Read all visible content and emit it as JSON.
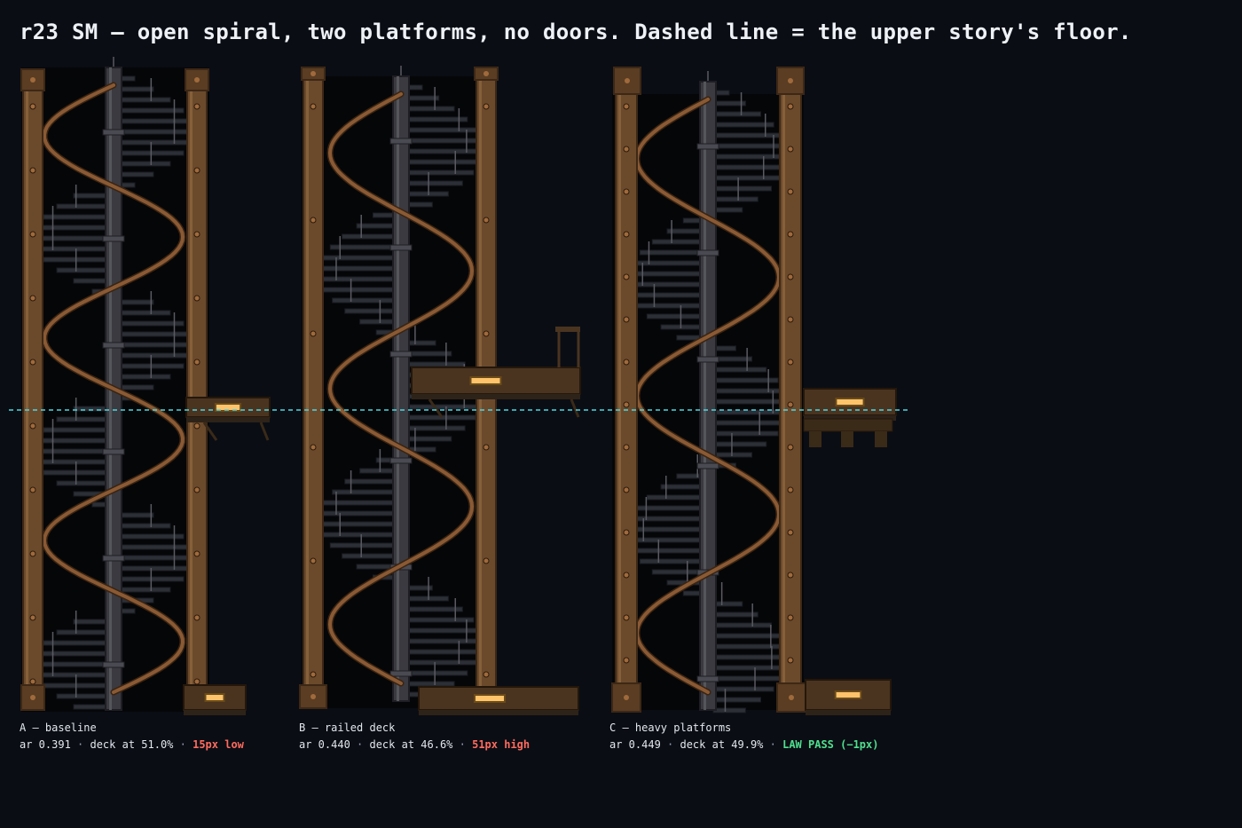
{
  "title": "r23 SM — open spiral, two platforms, no doors. Dashed line = the upper story's floor.",
  "colors": {
    "background": "#0a0d14",
    "beam": "#6b4a2c",
    "beam_dark": "#3d2816",
    "rivet": "#a06a3c",
    "pole": "#3a3a40",
    "step": "#2c2f36",
    "rail": "#8a5a34",
    "lamp": "#ffc46b",
    "dash_line": "#4fd6e0",
    "bad": "#ff6b5f",
    "good": "#4fe08e"
  },
  "variants": [
    {
      "label": "A — baseline",
      "ar": "ar 0.391",
      "deck": "deck at 51.0%",
      "verdict": "15px low",
      "verdict_status": "bad"
    },
    {
      "label": "B — railed deck",
      "ar": "ar 0.440",
      "deck": "deck at 46.6%",
      "verdict": "51px high",
      "verdict_status": "bad"
    },
    {
      "label": "C — heavy platforms",
      "ar": "ar 0.449",
      "deck": "deck at 49.9%",
      "verdict": "LAW PASS (−1px)",
      "verdict_status": "good"
    }
  ]
}
